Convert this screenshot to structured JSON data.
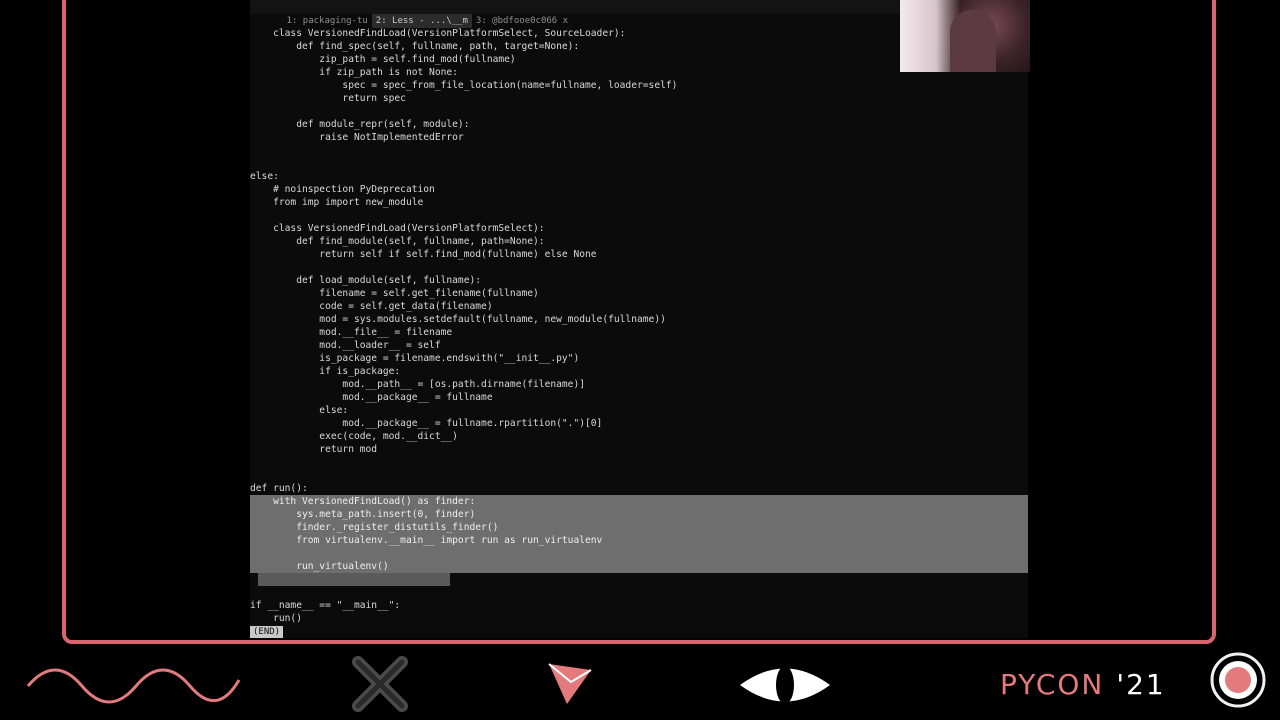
{
  "terminal": {
    "tabs": [
      {
        "label": "1: packaging-tu",
        "active": false
      },
      {
        "label": "2: Less - ...\\__m",
        "active": true
      },
      {
        "label": "3: @bdfooe0c066 x",
        "active": false
      }
    ],
    "code_lines": [
      {
        "text": "    class VersionedFindLoad(VersionPlatformSelect, SourceLoader):",
        "hl": ""
      },
      {
        "text": "        def find_spec(self, fullname, path, target=None):",
        "hl": ""
      },
      {
        "text": "            zip_path = self.find_mod(fullname)",
        "hl": ""
      },
      {
        "text": "            if zip_path is not None:",
        "hl": ""
      },
      {
        "text": "                spec = spec_from_file_location(name=fullname, loader=self)",
        "hl": ""
      },
      {
        "text": "                return spec",
        "hl": ""
      },
      {
        "text": "",
        "hl": ""
      },
      {
        "text": "        def module_repr(self, module):",
        "hl": ""
      },
      {
        "text": "            raise NotImplementedError",
        "hl": ""
      },
      {
        "text": "",
        "hl": ""
      },
      {
        "text": "",
        "hl": ""
      },
      {
        "text": "else:",
        "hl": ""
      },
      {
        "text": "    # noinspection PyDeprecation",
        "hl": ""
      },
      {
        "text": "    from imp import new_module",
        "hl": ""
      },
      {
        "text": "",
        "hl": ""
      },
      {
        "text": "    class VersionedFindLoad(VersionPlatformSelect):",
        "hl": ""
      },
      {
        "text": "        def find_module(self, fullname, path=None):",
        "hl": ""
      },
      {
        "text": "            return self if self.find_mod(fullname) else None",
        "hl": ""
      },
      {
        "text": "",
        "hl": ""
      },
      {
        "text": "        def load_module(self, fullname):",
        "hl": ""
      },
      {
        "text": "            filename = self.get_filename(fullname)",
        "hl": ""
      },
      {
        "text": "            code = self.get_data(filename)",
        "hl": ""
      },
      {
        "text": "            mod = sys.modules.setdefault(fullname, new_module(fullname))",
        "hl": ""
      },
      {
        "text": "            mod.__file__ = filename",
        "hl": ""
      },
      {
        "text": "            mod.__loader__ = self",
        "hl": ""
      },
      {
        "text": "            is_package = filename.endswith(\"__init__.py\")",
        "hl": ""
      },
      {
        "text": "            if is_package:",
        "hl": ""
      },
      {
        "text": "                mod.__path__ = [os.path.dirname(filename)]",
        "hl": ""
      },
      {
        "text": "                mod.__package__ = fullname",
        "hl": ""
      },
      {
        "text": "            else:",
        "hl": ""
      },
      {
        "text": "                mod.__package__ = fullname.rpartition(\".\")[0]",
        "hl": ""
      },
      {
        "text": "            exec(code, mod.__dict__)",
        "hl": ""
      },
      {
        "text": "            return mod",
        "hl": ""
      },
      {
        "text": "",
        "hl": ""
      },
      {
        "text": "",
        "hl": ""
      },
      {
        "text": "def run():",
        "hl": ""
      },
      {
        "text": "    with VersionedFindLoad() as finder:",
        "hl": "full"
      },
      {
        "text": "        sys.meta_path.insert(0, finder)",
        "hl": "full"
      },
      {
        "text": "        finder._register_distutils_finder()",
        "hl": "full"
      },
      {
        "text": "        from virtualenv.__main__ import run as run_virtualenv",
        "hl": "full"
      },
      {
        "text": "",
        "hl": "full"
      },
      {
        "text": "        run_virtualenv()",
        "hl": "full"
      },
      {
        "text": "",
        "hl": "partial"
      },
      {
        "text": "",
        "hl": ""
      },
      {
        "text": "if __name__ == \"__main__\":",
        "hl": ""
      },
      {
        "text": "    run()",
        "hl": ""
      }
    ],
    "status": "(END)"
  },
  "branding": {
    "name": "PYCON",
    "year": "'21",
    "accent_color": "#e27a7e",
    "frame_color": "#d9666e"
  },
  "footer_icons": [
    "wave-icon",
    "x-icon",
    "triangle-icon",
    "eye-icon",
    "target-icon"
  ]
}
